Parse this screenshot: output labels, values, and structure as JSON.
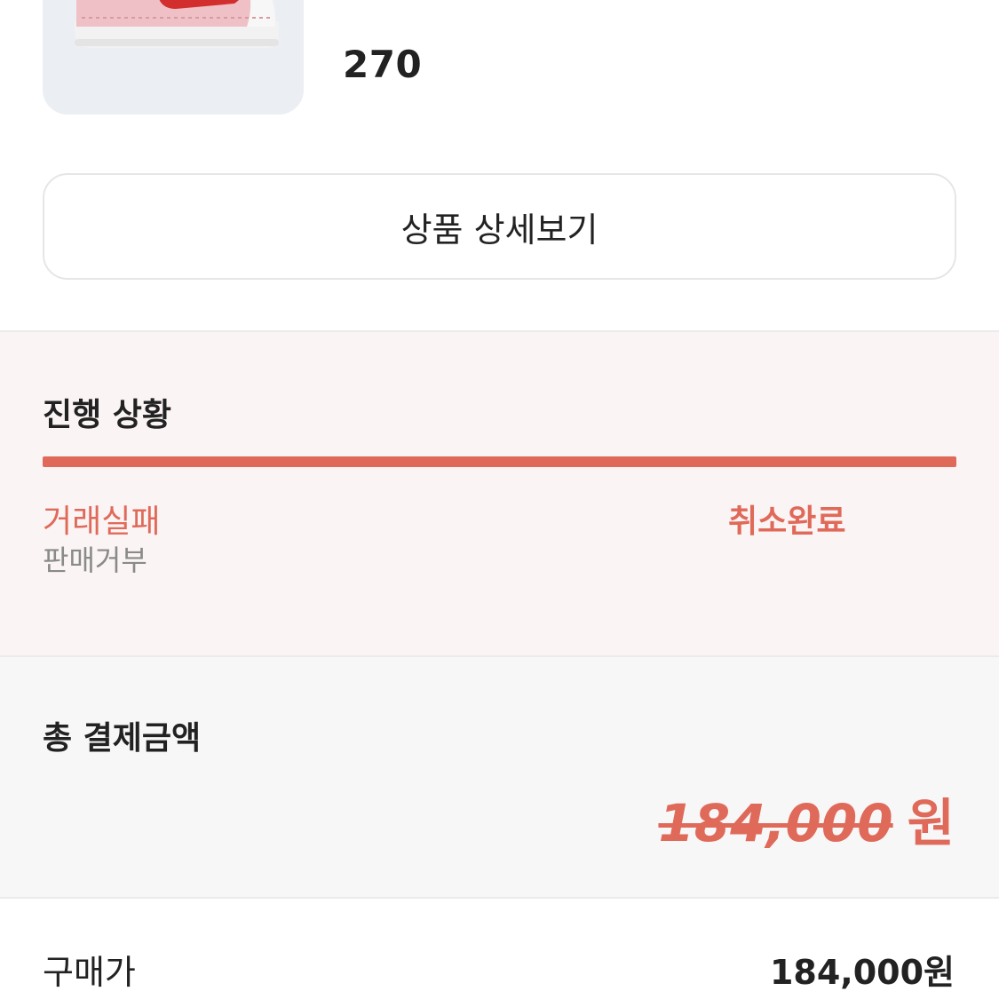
{
  "product": {
    "size": "270",
    "detail_button_label": "상품 상세보기",
    "image_icon": "sneaker-image"
  },
  "progress": {
    "title": "진행 상황",
    "fill_fraction": 1.0,
    "fill_color": "#e06a5a",
    "left_step": {
      "label": "거래실패",
      "sub_label": "판매거부"
    },
    "right_step": {
      "label": "취소완료"
    }
  },
  "payment": {
    "title": "총 결제금액",
    "total_amount": "184,000",
    "currency": "원"
  },
  "price": {
    "label": "구매가",
    "value": "184,000원"
  },
  "colors": {
    "accent": "#e06a5a",
    "progress_bg": "#fbf4f4",
    "payment_bg": "#f7f7f7"
  }
}
